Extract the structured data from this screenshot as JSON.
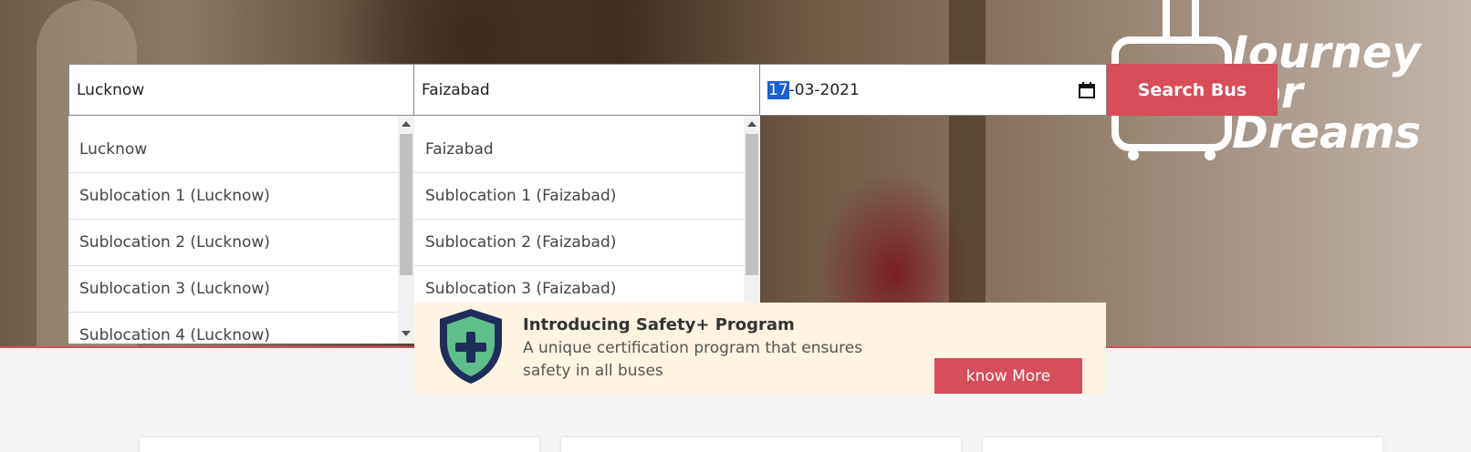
{
  "brand": {
    "logo_text_line1": "Journey",
    "logo_text_line2": "for",
    "logo_text_line3": "Dreams"
  },
  "search": {
    "from_value": "Lucknow",
    "to_value": "Faizabad",
    "date_day": "17",
    "date_rest": "-03-2021",
    "search_button": "Search Bus"
  },
  "from_options": [
    "Lucknow",
    "Sublocation 1 (Lucknow)",
    "Sublocation 2 (Lucknow)",
    "Sublocation 3 (Lucknow)",
    "Sublocation 4 (Lucknow)"
  ],
  "to_options": [
    "Faizabad",
    "Sublocation 1 (Faizabad)",
    "Sublocation 2 (Faizabad)",
    "Sublocation 3 (Faizabad)"
  ],
  "safety": {
    "title": "Introducing Safety+ Program",
    "description": "A unique certification program that ensures safety in all buses",
    "button": "know More"
  },
  "colors": {
    "accent": "#d74d59",
    "safety_bg": "#fff3e2",
    "shield_green": "#5fbf8a",
    "shield_navy": "#1f2d5a"
  },
  "icons": {
    "date": "calendar-icon",
    "safety": "shield-plus-icon",
    "logo": "suitcase-icon"
  }
}
